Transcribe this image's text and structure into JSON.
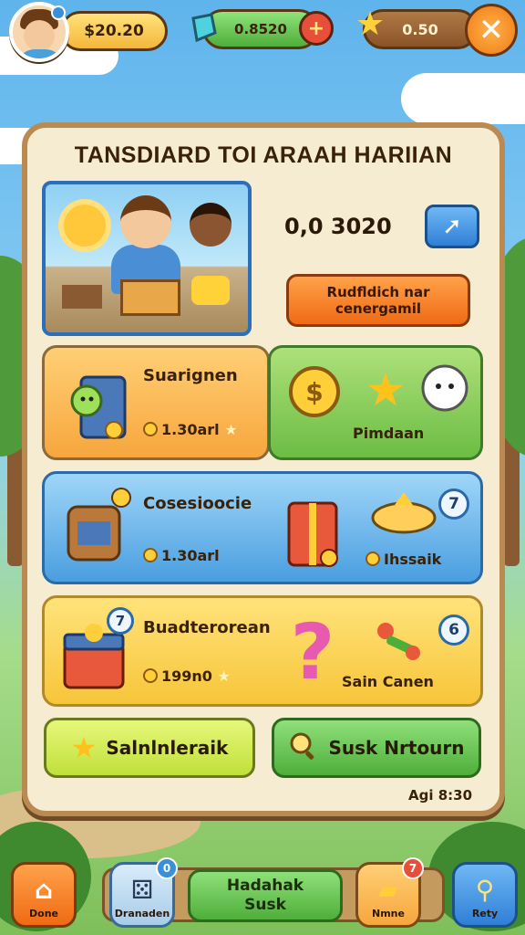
{
  "hud": {
    "coins": "$20.20",
    "gems": "0.8520",
    "stars": "0.50"
  },
  "panel": {
    "title": "TANSDIARD TOI ARAAH HARIIAN",
    "amount": "0,0 3020",
    "go_icon": "arrow-icon",
    "orange_button_line1": "Rudfldich nar",
    "orange_button_line2": "cenergamil"
  },
  "cards": {
    "orange": {
      "title": "Suarignen",
      "sub": "1.30arl"
    },
    "green": {
      "label": "Pimdaan"
    },
    "blue": {
      "title": "Cosesioocie",
      "sub": "1.30arl",
      "right_label": "Ihssaik",
      "badge": "7"
    },
    "yellow": {
      "title": "Buadterorean",
      "sub": "199n0",
      "right_label": "Sain Canen",
      "badge_left": "7",
      "badge_right": "6"
    }
  },
  "actions": {
    "left": "Salnlnleraik",
    "right": "Susk Nrtourn"
  },
  "timer": "Agi 8:30",
  "nav": {
    "home": "Done",
    "dice": "Dranaden",
    "dice_badge": "0",
    "mid_line1": "Hadahak",
    "mid_line2": "Susk",
    "gold": "Nmne",
    "gold_badge": "7",
    "search": "Rety"
  }
}
